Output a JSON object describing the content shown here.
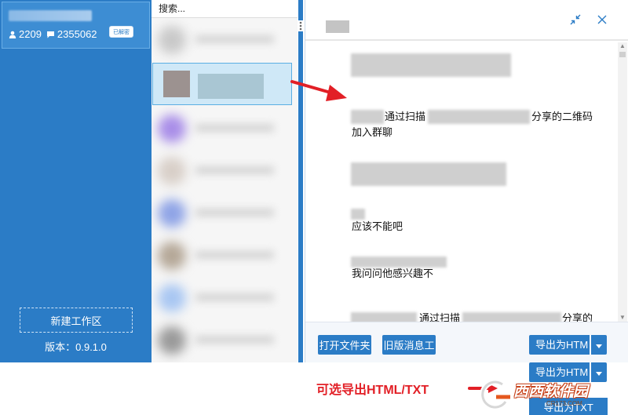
{
  "account": {
    "friends_count": "2209",
    "messages_count": "2355062",
    "decrypted_badge": "已解密"
  },
  "sidebar": {
    "new_workspace_label": "新建工作区",
    "version_label": "版本：",
    "version_value": "0.9.1.0"
  },
  "search": {
    "placeholder": "搜索..."
  },
  "chat": {
    "messages": [
      {
        "text": "通过扫描"
      },
      {
        "text": "分享的二维码"
      },
      {
        "text": "加入群聊"
      },
      {
        "text": "应该不能吧"
      },
      {
        "text": "我问问他感兴趣不"
      },
      {
        "text": "通过扫描"
      },
      {
        "text": "分享的"
      }
    ]
  },
  "footer": {
    "open_folder_label": "打开文件夹",
    "legacy_messages_label": "旧版消息工",
    "export_html_label": "导出为HTM",
    "export_txt_label": "导出为TXT"
  },
  "annotation": {
    "caption": "可选导出HTML/TXT"
  },
  "watermark": {
    "name": "西西软件园",
    "url": "CR173.COM"
  },
  "colors": {
    "accent": "#2b7cc6",
    "annotation_red": "#e21f26"
  }
}
